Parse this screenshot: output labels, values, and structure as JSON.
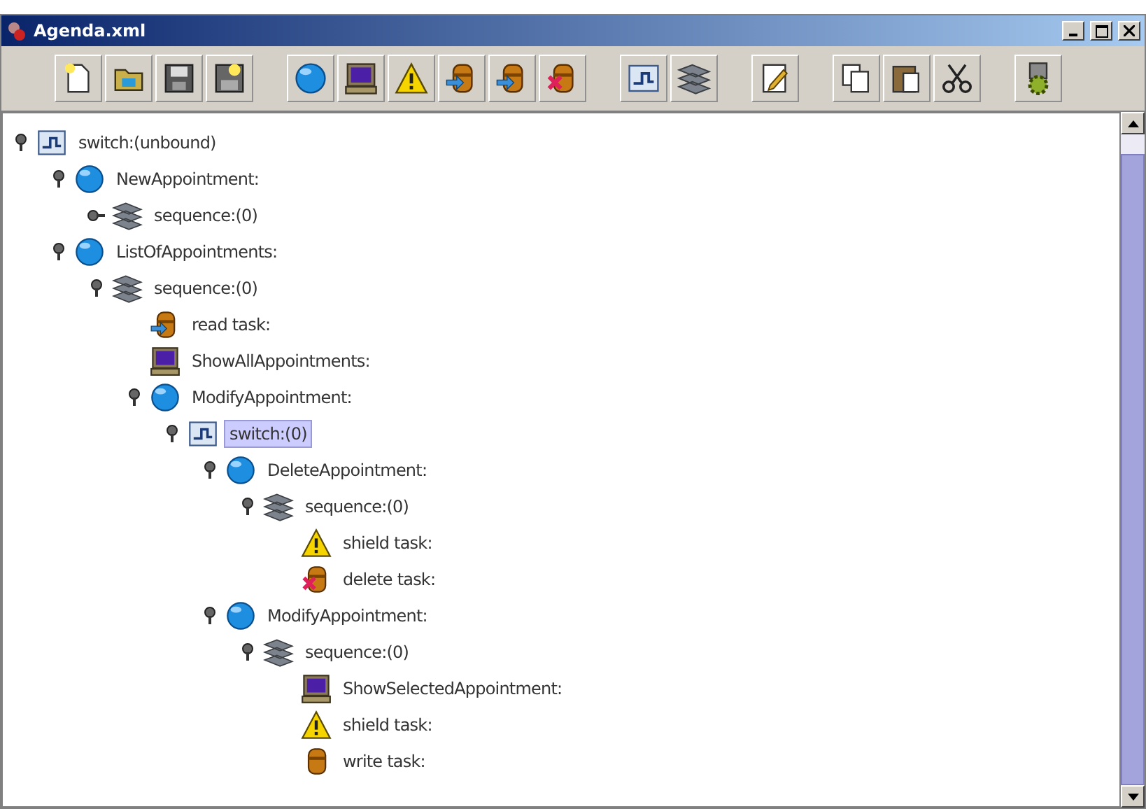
{
  "window": {
    "title": "Agenda.xml"
  },
  "toolbar": [
    {
      "kind": "new"
    },
    {
      "kind": "open"
    },
    {
      "kind": "save"
    },
    {
      "kind": "saveas"
    },
    {
      "kind": "gap"
    },
    {
      "kind": "activity"
    },
    {
      "kind": "view"
    },
    {
      "kind": "shield"
    },
    {
      "kind": "read"
    },
    {
      "kind": "read"
    },
    {
      "kind": "delete"
    },
    {
      "kind": "gap"
    },
    {
      "kind": "switch"
    },
    {
      "kind": "sequence"
    },
    {
      "kind": "gap"
    },
    {
      "kind": "edit"
    },
    {
      "kind": "gap"
    },
    {
      "kind": "copy"
    },
    {
      "kind": "paste"
    },
    {
      "kind": "cut"
    },
    {
      "kind": "gap"
    },
    {
      "kind": "run"
    }
  ],
  "tree": [
    {
      "kind": "switch",
      "label": "switch:(unbound)",
      "expanded": true,
      "selected": false,
      "children": [
        {
          "kind": "activity",
          "label": "NewAppointment:",
          "expanded": true,
          "selected": false,
          "children": [
            {
              "kind": "sequence",
              "label": "sequence:(0)",
              "expanded": false,
              "selected": false
            }
          ]
        },
        {
          "kind": "activity",
          "label": "ListOfAppointments:",
          "expanded": true,
          "selected": false,
          "children": [
            {
              "kind": "sequence",
              "label": "sequence:(0)",
              "expanded": true,
              "selected": false,
              "children": [
                {
                  "kind": "read",
                  "label": "read task:",
                  "selected": false
                },
                {
                  "kind": "view",
                  "label": "ShowAllAppointments:",
                  "selected": false
                },
                {
                  "kind": "activity",
                  "label": "ModifyAppointment:",
                  "expanded": true,
                  "selected": false,
                  "children": [
                    {
                      "kind": "switch",
                      "label": "switch:(0)",
                      "expanded": true,
                      "selected": true,
                      "children": [
                        {
                          "kind": "activity",
                          "label": "DeleteAppointment:",
                          "expanded": true,
                          "selected": false,
                          "children": [
                            {
                              "kind": "sequence",
                              "label": "sequence:(0)",
                              "expanded": true,
                              "selected": false,
                              "children": [
                                {
                                  "kind": "shield",
                                  "label": "shield task:",
                                  "selected": false
                                },
                                {
                                  "kind": "delete",
                                  "label": "delete task:",
                                  "selected": false
                                }
                              ]
                            }
                          ]
                        },
                        {
                          "kind": "activity",
                          "label": "ModifyAppointment:",
                          "expanded": true,
                          "selected": false,
                          "children": [
                            {
                              "kind": "sequence",
                              "label": "sequence:(0)",
                              "expanded": true,
                              "selected": false,
                              "children": [
                                {
                                  "kind": "view",
                                  "label": "ShowSelectedAppointment:",
                                  "selected": false
                                },
                                {
                                  "kind": "shield",
                                  "label": "shield task:",
                                  "selected": false
                                },
                                {
                                  "kind": "write",
                                  "label": "write task:",
                                  "selected": false
                                }
                              ]
                            }
                          ]
                        }
                      ]
                    }
                  ]
                }
              ]
            }
          ]
        }
      ]
    }
  ]
}
